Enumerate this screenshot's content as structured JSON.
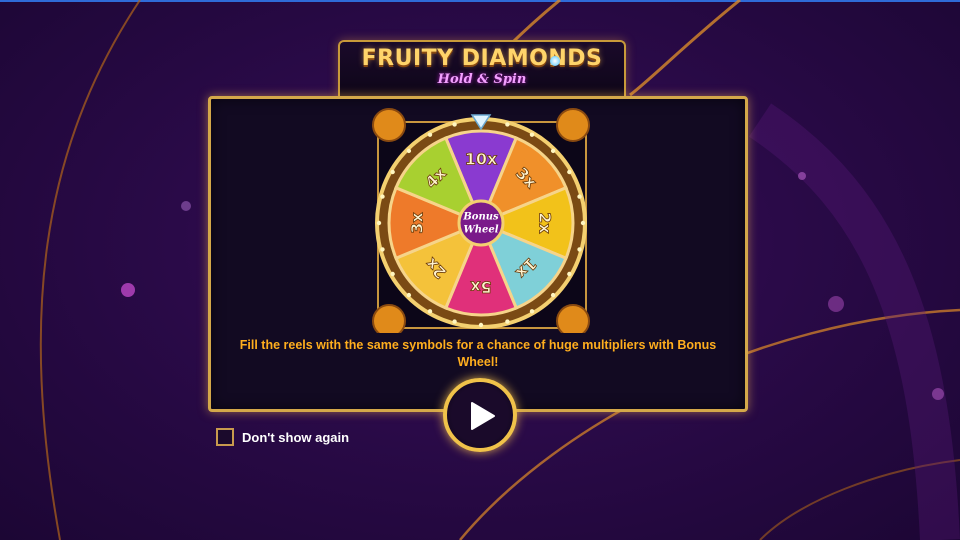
{
  "game": {
    "title": "FRUITY DIAMONDS",
    "subtitle": "Hold & Spin"
  },
  "wheel": {
    "center_label_line1": "Bonus",
    "center_label_line2": "Wheel",
    "segments": [
      {
        "label": "10x",
        "color": "#8a3ad0"
      },
      {
        "label": "3x",
        "color": "#f0902a"
      },
      {
        "label": "2x",
        "color": "#f2c21a"
      },
      {
        "label": "1x",
        "color": "#7fd0d8"
      },
      {
        "label": "5x",
        "color": "#e0307a"
      },
      {
        "label": "2x",
        "color": "#f4c23a"
      },
      {
        "label": "3x",
        "color": "#ee7a2a"
      },
      {
        "label": "4x",
        "color": "#a8d030"
      }
    ]
  },
  "description": "Fill the reels with the same symbols for a chance of huge multipliers with Bonus Wheel!",
  "play_button": {
    "icon": "play-icon"
  },
  "dont_show": {
    "label": "Don't show again",
    "checked": false
  },
  "colors": {
    "accent_gold": "#f0c24a",
    "text_orange": "#ffae1e",
    "background": "#2a0a48"
  }
}
